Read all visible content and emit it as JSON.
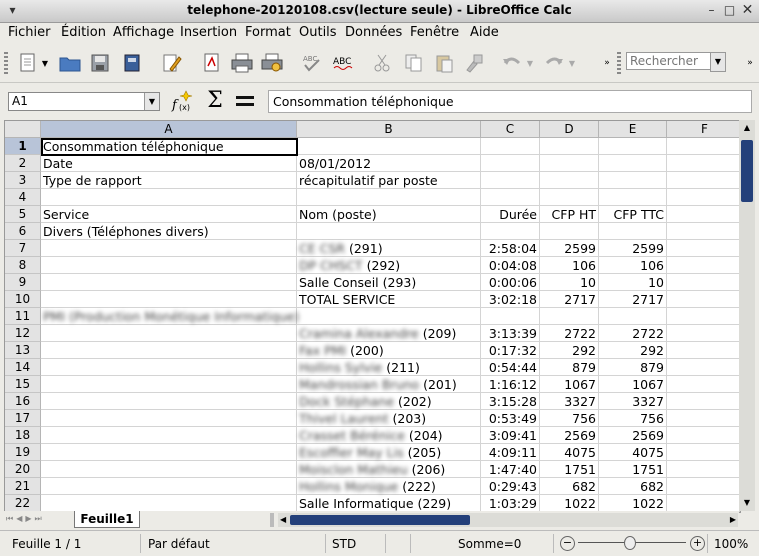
{
  "window": {
    "title": "telephone-20120108.csv(lecture seule) - LibreOffice Calc"
  },
  "menu": [
    "Fichier",
    "Édition",
    "Affichage",
    "Insertion",
    "Format",
    "Outils",
    "Données",
    "Fenêtre",
    "Aide"
  ],
  "toolbar": {
    "search_placeholder": "Rechercher"
  },
  "formula": {
    "cell_ref": "A1",
    "content": "Consommation téléphonique"
  },
  "columns": [
    "A",
    "B",
    "C",
    "D",
    "E",
    "F"
  ],
  "rows": [
    {
      "n": "1",
      "a": "Consommation téléphonique",
      "b": "",
      "c": "",
      "d": "",
      "e": ""
    },
    {
      "n": "2",
      "a": "Date",
      "b": "08/01/2012",
      "c": "",
      "d": "",
      "e": ""
    },
    {
      "n": "3",
      "a": "Type de rapport",
      "b": "récapitulatif par poste",
      "c": "",
      "d": "",
      "e": ""
    },
    {
      "n": "4",
      "a": "",
      "b": "",
      "c": "",
      "d": "",
      "e": ""
    },
    {
      "n": "5",
      "a": "Service",
      "b": "Nom (poste)",
      "c": "Durée",
      "d": "CFP HT",
      "e": "CFP TTC"
    },
    {
      "n": "6",
      "a": "Divers (Téléphones divers)",
      "b": "",
      "c": "",
      "d": "",
      "e": ""
    },
    {
      "n": "7",
      "a": "",
      "b_blur": "CE CSR",
      "b": "(291)",
      "c": "2:58:04",
      "d": "2599",
      "e": "2599"
    },
    {
      "n": "8",
      "a": "",
      "b_blur": "DP CHSCT",
      "b": "(292)",
      "c": "0:04:08",
      "d": "106",
      "e": "106"
    },
    {
      "n": "9",
      "a": "",
      "b": "Salle Conseil (293)",
      "c": "0:00:06",
      "d": "10",
      "e": "10"
    },
    {
      "n": "10",
      "a": "",
      "b": "TOTAL SERVICE",
      "c": "3:02:18",
      "d": "2717",
      "e": "2717"
    },
    {
      "n": "11",
      "a_blur": "PMI (Production Monétique Informatique)",
      "b": "",
      "c": "",
      "d": "",
      "e": ""
    },
    {
      "n": "12",
      "a": "",
      "b_blur": "Cramina Alexandre",
      "b": "(209)",
      "c": "3:13:39",
      "d": "2722",
      "e": "2722"
    },
    {
      "n": "13",
      "a": "",
      "b_blur": "Fax PMI",
      "b": "(200)",
      "c": "0:17:32",
      "d": "292",
      "e": "292"
    },
    {
      "n": "14",
      "a": "",
      "b_blur": "Hollins Sylvie",
      "b": "(211)",
      "c": "0:54:44",
      "d": "879",
      "e": "879"
    },
    {
      "n": "15",
      "a": "",
      "b_blur": "Mandrossian Bruno",
      "b": "(201)",
      "c": "1:16:12",
      "d": "1067",
      "e": "1067"
    },
    {
      "n": "16",
      "a": "",
      "b_blur": "Dock Stéphane",
      "b": "(202)",
      "c": "3:15:28",
      "d": "3327",
      "e": "3327"
    },
    {
      "n": "17",
      "a": "",
      "b_blur": "Thivel Laurent",
      "b": "(203)",
      "c": "0:53:49",
      "d": "756",
      "e": "756"
    },
    {
      "n": "18",
      "a": "",
      "b_blur": "Crasset Bérénice",
      "b": "(204)",
      "c": "3:09:41",
      "d": "2569",
      "e": "2569"
    },
    {
      "n": "19",
      "a": "",
      "b_blur": "Escoffier May Lis",
      "b": "(205)",
      "c": "4:09:11",
      "d": "4075",
      "e": "4075"
    },
    {
      "n": "20",
      "a": "",
      "b_blur": "Moisclon Mathieu",
      "b": "(206)",
      "c": "1:47:40",
      "d": "1751",
      "e": "1751"
    },
    {
      "n": "21",
      "a": "",
      "b_blur": "Hollins Monique",
      "b": "(222)",
      "c": "0:29:43",
      "d": "682",
      "e": "682"
    },
    {
      "n": "22",
      "a": "",
      "b": "Salle Informatique (229)",
      "c": "1:03:29",
      "d": "1022",
      "e": "1022"
    }
  ],
  "sheet_tab": "Feuille1",
  "status": {
    "sheet": "Feuille 1 / 1",
    "style": "Par défaut",
    "mode": "STD",
    "sum": "Somme=0",
    "zoom": "100%"
  },
  "colors": {
    "selection_header": "#b8c4d8",
    "scroll_thumb": "#24407a"
  }
}
